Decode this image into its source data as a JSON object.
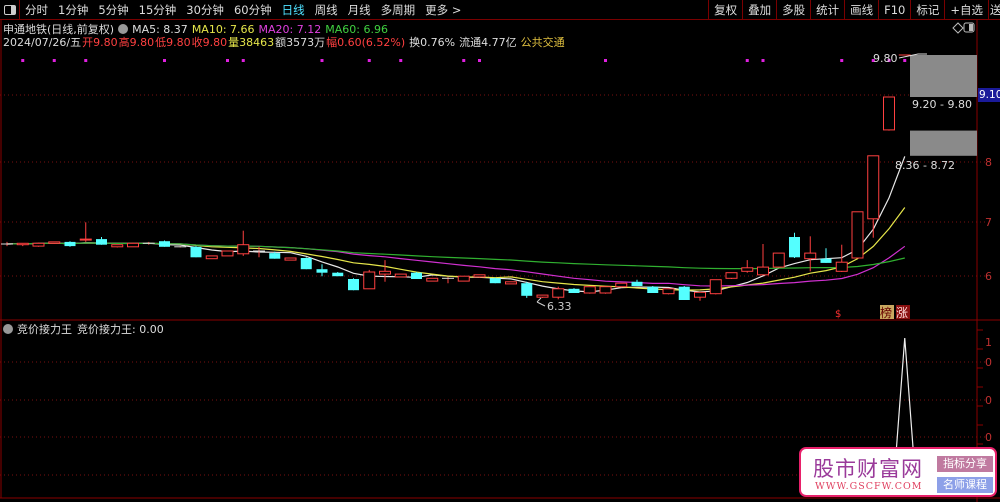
{
  "toolbar": {
    "periods": [
      "分时",
      "1分钟",
      "5分钟",
      "15分钟",
      "30分钟",
      "60分钟",
      "日线",
      "周线",
      "月线",
      "多周期",
      "更多 >"
    ],
    "active_period": "日线",
    "right_buttons": [
      "复权",
      "叠加",
      "多股",
      "统计",
      "画线",
      "F10",
      "标记",
      "+自选",
      "送"
    ]
  },
  "header": {
    "title": "申通地铁(日线,前复权)",
    "ma5": "MA5: 8.37",
    "ma10": "MA10: 7.66",
    "ma20": "MA20: 7.12",
    "ma60": "MA60: 6.96"
  },
  "quote": {
    "date": "2024/07/26/五",
    "open": "开9.80",
    "high": "高9.80",
    "low": "低9.80",
    "close": "收9.80",
    "volume": "量38463",
    "amount": "额3573万",
    "change": "幅0.60(6.52%)",
    "turnover": "换0.76%",
    "float": "流通4.77亿",
    "sector": "公共交通"
  },
  "price_tag": "9.10",
  "annotations": {
    "high_label": "9.80",
    "low_label": "6.33",
    "zone_upper": "9.20 - 9.80",
    "zone_lower": "8.36 - 8.72",
    "badge_dollar": "$",
    "badge_list": "榜",
    "badge_rise": "涨"
  },
  "axis": {
    "main_labels": [
      "8",
      "7",
      "6"
    ],
    "sub_labels": [
      "1",
      "0",
      "0",
      "0"
    ]
  },
  "sub": {
    "title": "竞价接力王",
    "label": "竞价接力王: 0.00"
  },
  "logo": {
    "name": "股市财富网",
    "url": "WWW.GSCFW.COM",
    "tag1": "指标分享",
    "tag2": "名师课程"
  },
  "colors": {
    "up": "#ff4040",
    "down": "#54ffff",
    "ma5": "#e8e8e8",
    "ma10": "#e6e64a",
    "ma20": "#d030d0",
    "ma60": "#30b030"
  },
  "chart_data": {
    "type": "candlestick",
    "ohlc": [
      [
        7.1,
        7.13,
        7.07,
        7.1
      ],
      [
        7.09,
        7.11,
        7.07,
        7.11
      ],
      [
        7.07,
        7.12,
        7.06,
        7.11
      ],
      [
        7.11,
        7.13,
        7.1,
        7.13
      ],
      [
        7.13,
        7.14,
        7.06,
        7.07
      ],
      [
        7.16,
        7.41,
        7.13,
        7.17
      ],
      [
        7.17,
        7.2,
        7.09,
        7.09
      ],
      [
        7.06,
        7.09,
        7.05,
        7.09
      ],
      [
        7.06,
        7.12,
        7.06,
        7.11
      ],
      [
        7.11,
        7.13,
        7.09,
        7.11
      ],
      [
        7.14,
        7.15,
        7.06,
        7.06
      ],
      [
        7.06,
        7.07,
        7.05,
        7.06
      ],
      [
        7.06,
        7.07,
        6.91,
        6.91
      ],
      [
        6.89,
        6.93,
        6.89,
        6.93
      ],
      [
        6.93,
        7.0,
        6.93,
        7.0
      ],
      [
        6.96,
        7.29,
        6.93,
        7.09
      ],
      [
        7.0,
        7.06,
        6.91,
        7.0
      ],
      [
        6.97,
        6.99,
        6.89,
        6.89
      ],
      [
        6.87,
        6.9,
        6.87,
        6.9
      ],
      [
        6.9,
        6.91,
        6.74,
        6.74
      ],
      [
        6.74,
        6.81,
        6.64,
        6.69
      ],
      [
        6.69,
        6.7,
        6.64,
        6.64
      ],
      [
        6.6,
        6.61,
        6.44,
        6.44
      ],
      [
        6.46,
        6.73,
        6.46,
        6.7
      ],
      [
        6.67,
        6.87,
        6.56,
        6.71
      ],
      [
        6.63,
        6.67,
        6.63,
        6.67
      ],
      [
        6.69,
        6.7,
        6.6,
        6.6
      ],
      [
        6.57,
        6.61,
        6.57,
        6.61
      ],
      [
        6.61,
        6.63,
        6.54,
        6.61
      ],
      [
        6.57,
        6.64,
        6.57,
        6.64
      ],
      [
        6.63,
        6.66,
        6.62,
        6.66
      ],
      [
        6.61,
        6.62,
        6.54,
        6.54
      ],
      [
        6.53,
        6.56,
        6.53,
        6.56
      ],
      [
        6.54,
        6.56,
        6.33,
        6.36
      ],
      [
        6.34,
        6.37,
        6.33,
        6.37
      ],
      [
        6.34,
        6.49,
        6.31,
        6.46
      ],
      [
        6.46,
        6.47,
        6.4,
        6.4
      ],
      [
        6.4,
        6.49,
        6.39,
        6.49
      ],
      [
        6.4,
        6.49,
        6.39,
        6.49
      ],
      [
        6.49,
        6.54,
        6.48,
        6.54
      ],
      [
        6.56,
        6.59,
        6.5,
        6.5
      ],
      [
        6.49,
        6.5,
        6.4,
        6.4
      ],
      [
        6.39,
        6.46,
        6.38,
        6.46
      ],
      [
        6.49,
        6.5,
        6.3,
        6.3
      ],
      [
        6.34,
        6.41,
        6.29,
        6.41
      ],
      [
        6.39,
        6.59,
        6.38,
        6.59
      ],
      [
        6.61,
        6.69,
        6.6,
        6.69
      ],
      [
        6.71,
        6.87,
        6.69,
        6.76
      ],
      [
        6.66,
        7.1,
        6.66,
        6.77
      ],
      [
        6.77,
        6.97,
        6.77,
        6.97
      ],
      [
        7.2,
        7.26,
        6.9,
        6.91
      ],
      [
        6.89,
        7.21,
        6.71,
        6.97
      ],
      [
        6.89,
        7.04,
        6.83,
        6.83
      ],
      [
        6.71,
        7.09,
        6.7,
        6.84
      ],
      [
        6.9,
        7.56,
        6.9,
        7.56
      ],
      [
        7.46,
        8.36,
        7.19,
        8.36
      ],
      [
        8.73,
        9.2,
        8.72,
        9.2
      ],
      [
        9.8,
        9.8,
        9.8,
        9.8
      ]
    ],
    "ma_periods": [
      5,
      10,
      20,
      60
    ],
    "signal_dots": [
      1,
      3,
      5,
      10,
      14,
      15,
      20,
      23,
      25,
      29,
      30,
      38,
      47,
      48,
      53,
      55,
      56,
      57
    ],
    "zones": [
      [
        9.2,
        9.8
      ],
      [
        8.36,
        8.72
      ]
    ],
    "indicator_values_spike_index": 57,
    "indicator_value": 0.0,
    "ylim": [
      6.0,
      9.9
    ]
  }
}
